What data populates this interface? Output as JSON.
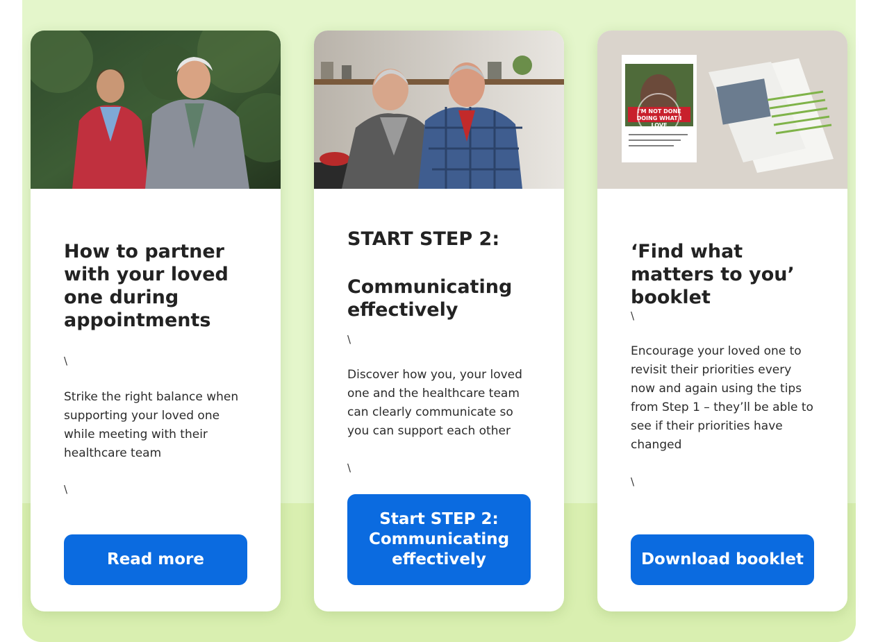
{
  "cards": [
    {
      "title": "How to partner with your loved one during appointments",
      "slash_top": "\\",
      "description": "Strike the right balance when supporting your loved one while meeting with their healthcare team",
      "slash_bottom": "\\",
      "button_label": "Read more",
      "image_icon": "photo-couple-outdoors"
    },
    {
      "title_line1": "START STEP 2:",
      "title_line2": "Communicating effectively",
      "slash_top": "\\",
      "description": "Discover how you, your loved one and the healthcare team can clearly communicate so you can support each other",
      "slash_bottom": "\\",
      "button_label": "Start STEP 2: Communicating effectively",
      "image_icon": "photo-couple-kitchen"
    },
    {
      "title": "‘Find what matters to you’ booklet",
      "slash_top": "\\",
      "description": "Encourage your loved one to revisit their priorities every now and again using the tips from Step 1 – they’ll be able to see if their priorities have changed",
      "slash_bottom": "\\",
      "button_label": "Download booklet",
      "image_icon": "photo-booklet",
      "booklet_cover_text": "I'M NOT DONE DOING WHAT I LOVE"
    }
  ],
  "colors": {
    "panel_background": "#e4f6cb",
    "panel_band": "#d9efb0",
    "button": "#0b6be0",
    "button_text": "#ffffff"
  }
}
